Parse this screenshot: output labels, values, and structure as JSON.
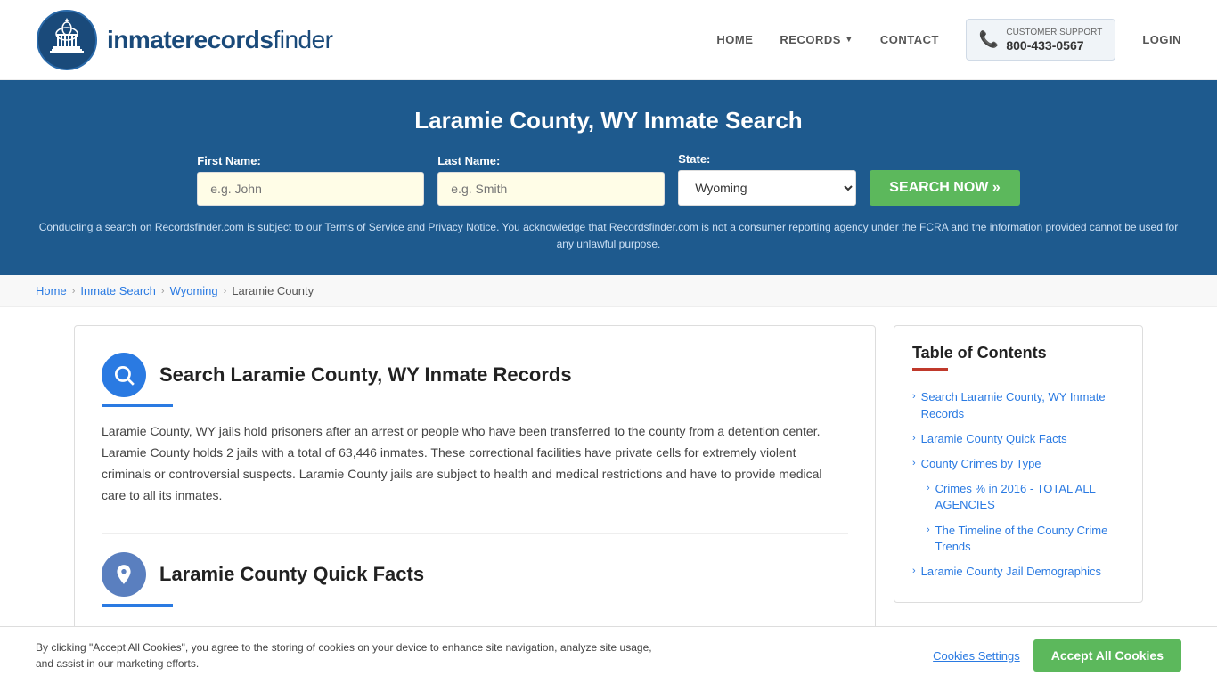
{
  "header": {
    "logo_text_main": "inmaterecords",
    "logo_text_bold": "finder",
    "nav": {
      "home": "HOME",
      "records": "RECORDS",
      "contact": "CONTACT",
      "login": "LOGIN"
    },
    "support": {
      "label": "CUSTOMER SUPPORT",
      "number": "800-433-0567"
    }
  },
  "hero": {
    "title": "Laramie County, WY Inmate Search",
    "first_name_label": "First Name:",
    "first_name_placeholder": "e.g. John",
    "last_name_label": "Last Name:",
    "last_name_placeholder": "e.g. Smith",
    "state_label": "State:",
    "state_value": "Wyoming",
    "search_button": "SEARCH NOW »",
    "disclaimer": "Conducting a search on Recordsfinder.com is subject to our Terms of Service and Privacy Notice. You acknowledge that Recordsfinder.com is not a consumer reporting agency under the FCRA and the information provided cannot be used for any unlawful purpose."
  },
  "breadcrumb": {
    "home": "Home",
    "inmate_search": "Inmate Search",
    "wyoming": "Wyoming",
    "laramie_county": "Laramie County"
  },
  "content": {
    "section1": {
      "title": "Search Laramie County, WY Inmate Records",
      "body": "Laramie County, WY jails hold prisoners after an arrest or people who have been transferred to the county from a detention center. Laramie County holds 2 jails with a total of 63,446 inmates. These correctional facilities have private cells for extremely violent criminals or controversial suspects. Laramie County jails are subject to health and medical restrictions and have to provide medical care to all its inmates."
    },
    "section2": {
      "title": "Laramie County Quick Facts"
    }
  },
  "toc": {
    "title": "Table of Contents",
    "items": [
      {
        "label": "Search Laramie County, WY Inmate Records",
        "sub": false
      },
      {
        "label": "Laramie County Quick Facts",
        "sub": false
      },
      {
        "label": "County Crimes by Type",
        "sub": false
      },
      {
        "label": "Crimes % in 2016 - TOTAL ALL AGENCIES",
        "sub": true
      },
      {
        "label": "The Timeline of the County Crime Trends",
        "sub": true
      },
      {
        "label": "Laramie County Jail Demographics",
        "sub": false
      }
    ]
  },
  "cookie_banner": {
    "text": "By clicking \"Accept All Cookies\", you agree to the storing of cookies on your device to enhance site navigation, analyze site usage, and assist in our marketing efforts.",
    "settings_label": "Cookies Settings",
    "accept_label": "Accept All Cookies"
  }
}
